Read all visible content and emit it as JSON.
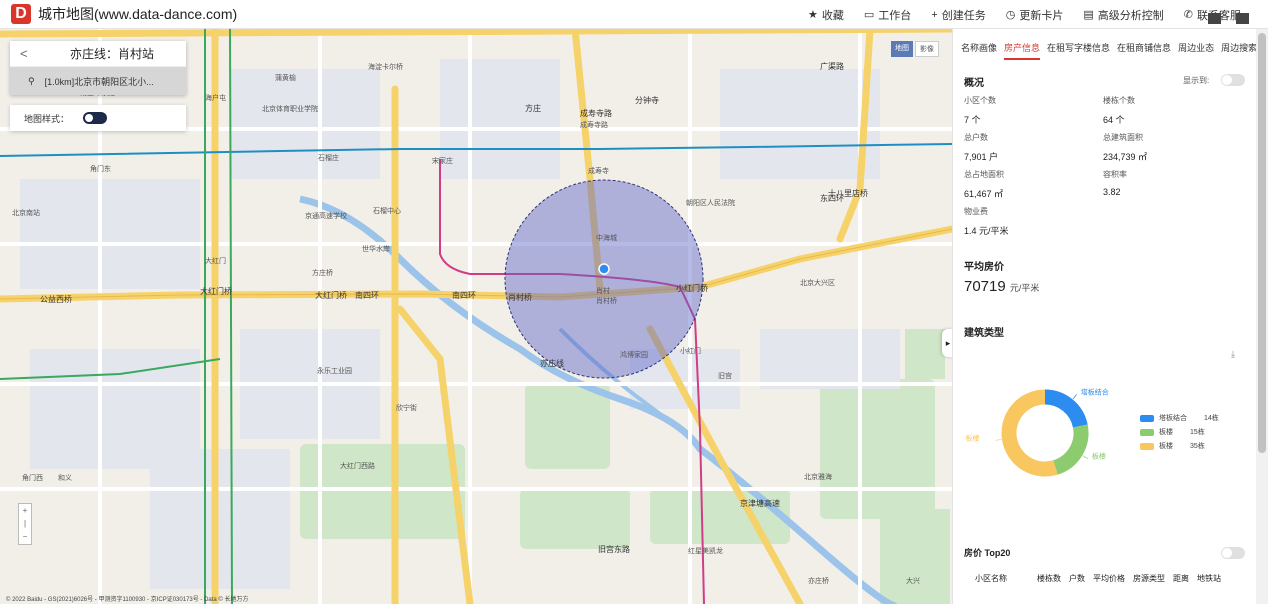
{
  "app": {
    "logo_letter": "D",
    "title": "城市地图(www.data-dance.com)"
  },
  "topnav": [
    {
      "icon": "star-icon",
      "glyph": "★",
      "label": "收藏"
    },
    {
      "icon": "monitor-icon",
      "glyph": "▭",
      "label": "工作台"
    },
    {
      "icon": "plus-icon",
      "glyph": "+",
      "label": "创建任务"
    },
    {
      "icon": "clock-icon",
      "glyph": "◷",
      "label": "更新卡片"
    },
    {
      "icon": "report-icon",
      "glyph": "▤",
      "label": "高级分析控制"
    },
    {
      "icon": "phone-icon",
      "glyph": "✆",
      "label": "联系客服"
    }
  ],
  "route": {
    "back": "<",
    "title": "亦庄线：肖村站",
    "item": "[1.0km]北京市朝阳区北小..."
  },
  "map_style": {
    "label": "地图样式："
  },
  "map_type": {
    "a": "地图",
    "b": "影像"
  },
  "zoom": {
    "plus": "+",
    "minus": "−"
  },
  "copyright": "© 2022 Baidu - GS(2021)6026号 - 甲测资字1100930 - 京ICP证030173号 - Data © 长地万方",
  "map_labels": {
    "roads": [
      "南三环",
      "南三环",
      "南四环",
      "南四环",
      "大红门桥",
      "公益西桥",
      "大红门桥",
      "旧宫东路",
      "广渠路",
      "东四环",
      "京津塘高速",
      "成寿寺路",
      "分钟寺",
      "十八里店桥",
      "小红门桥",
      "亦庄线",
      "肖村桥",
      "方庄"
    ],
    "places": [
      "北京南站",
      "大红门",
      "方庄桥",
      "蒲黄榆",
      "北京体育职业学院",
      "石榴庄",
      "宋家庄",
      "成寿寺",
      "肖村",
      "肖村桥",
      "朝阳区人民法院",
      "中海城",
      "小红门",
      "鸿博家园",
      "京通高速学校",
      "海户屯",
      "赵公口桥",
      "角门东",
      "世华水岸",
      "海淀卡尔桥",
      "永乐工业园",
      "欣宁街",
      "旧宫",
      "亦庄桥",
      "大红门西路",
      "和义",
      "北京雅海",
      "红星美凯龙",
      "大兴",
      "角门西",
      "石榴中心",
      "南三环东路",
      "北京大兴区",
      "成寿寺路"
    ]
  },
  "tabs": [
    "名称画像",
    "房产信息",
    "在租写字楼信息",
    "在租商铺信息",
    "周边业态",
    "周边搜索"
  ],
  "active_tab": 1,
  "overview": {
    "title": "概况",
    "toggle_label": "显示到:",
    "items": [
      {
        "k": "小区个数",
        "v": "7 个"
      },
      {
        "k": "楼栋个数",
        "v": "64 个"
      },
      {
        "k": "总户数",
        "v": "7,901 户"
      },
      {
        "k": "总建筑面积",
        "v": "234,739 ㎡"
      },
      {
        "k": "总占地面积",
        "v": "61,467 ㎡"
      },
      {
        "k": "容积率",
        "v": "3.82"
      },
      {
        "k": "物业费",
        "v": "1.4 元/平米"
      }
    ]
  },
  "avg_price": {
    "title": "平均房价",
    "value": "70719",
    "unit": "元/平米"
  },
  "building_type": {
    "title": "建筑类型",
    "download_icon": "download-icon",
    "segments": [
      {
        "name": "塔板结合",
        "count": "14栋",
        "value": 14,
        "color": "#2d8cf0"
      },
      {
        "name": "板楼",
        "count": "15栋",
        "value": 15,
        "color": "#8ccb6e"
      },
      {
        "name": "板楼",
        "count": "35栋",
        "value": 35,
        "color": "#f8c760"
      }
    ],
    "callouts": [
      "塔板结合",
      "板楼",
      "板楼"
    ]
  },
  "top20": {
    "title": "房价 Top20",
    "columns": [
      "小区名称",
      "楼栋数",
      "户数",
      "平均价格",
      "房源类型",
      "距离",
      "地铁站"
    ]
  }
}
